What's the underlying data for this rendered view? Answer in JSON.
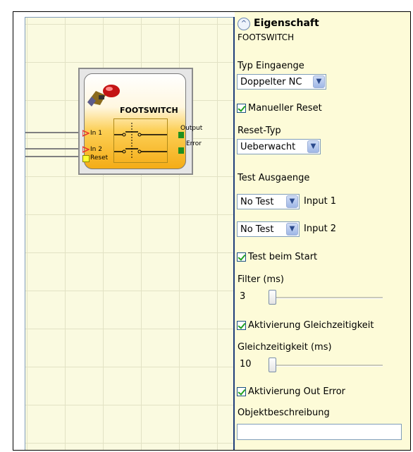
{
  "canvas": {
    "block": {
      "title": "FOOTSWITCH",
      "inputs": [
        "In 1",
        "In 2",
        "Reset"
      ],
      "outputs": [
        "Output",
        "Error"
      ]
    }
  },
  "panel": {
    "collapse_icon": "chevron-up-icon",
    "title": "Eigenschaft",
    "object_name": "FOOTSWITCH",
    "typ_eingaenge": {
      "label": "Typ Eingaenge",
      "value": "Doppelter NC"
    },
    "manueller_reset": {
      "label": "Manueller Reset",
      "checked": true
    },
    "reset_typ": {
      "label": "Reset-Typ",
      "value": "Ueberwacht"
    },
    "test_ausgaenge": {
      "label": "Test Ausgaenge",
      "rows": [
        {
          "value": "No Test",
          "input_label": "Input 1"
        },
        {
          "value": "No Test",
          "input_label": "Input 2"
        }
      ]
    },
    "test_beim_start": {
      "label": "Test beim Start",
      "checked": true
    },
    "filter": {
      "label": "Filter (ms)",
      "value": "3",
      "slider_fraction": 0.0
    },
    "aktivierung_gleichzeitigkeit": {
      "label": "Aktivierung Gleichzeitigkeit",
      "checked": true
    },
    "gleichzeitigkeit": {
      "label": "Gleichzeitigkeit (ms)",
      "value": "10",
      "slider_fraction": 0.0
    },
    "aktivierung_out_error": {
      "label": "Aktivierung Out Error",
      "checked": true
    },
    "objektbeschreibung": {
      "label": "Objektbeschreibung",
      "value": ""
    }
  },
  "colors": {
    "canvas_bg": "#fafae0",
    "panel_bg": "#fdfbd8",
    "block_orange": "#f4ac16",
    "check_green": "#21a121",
    "pin_red": "#e8322c",
    "pin_green": "#1f8f1f"
  }
}
